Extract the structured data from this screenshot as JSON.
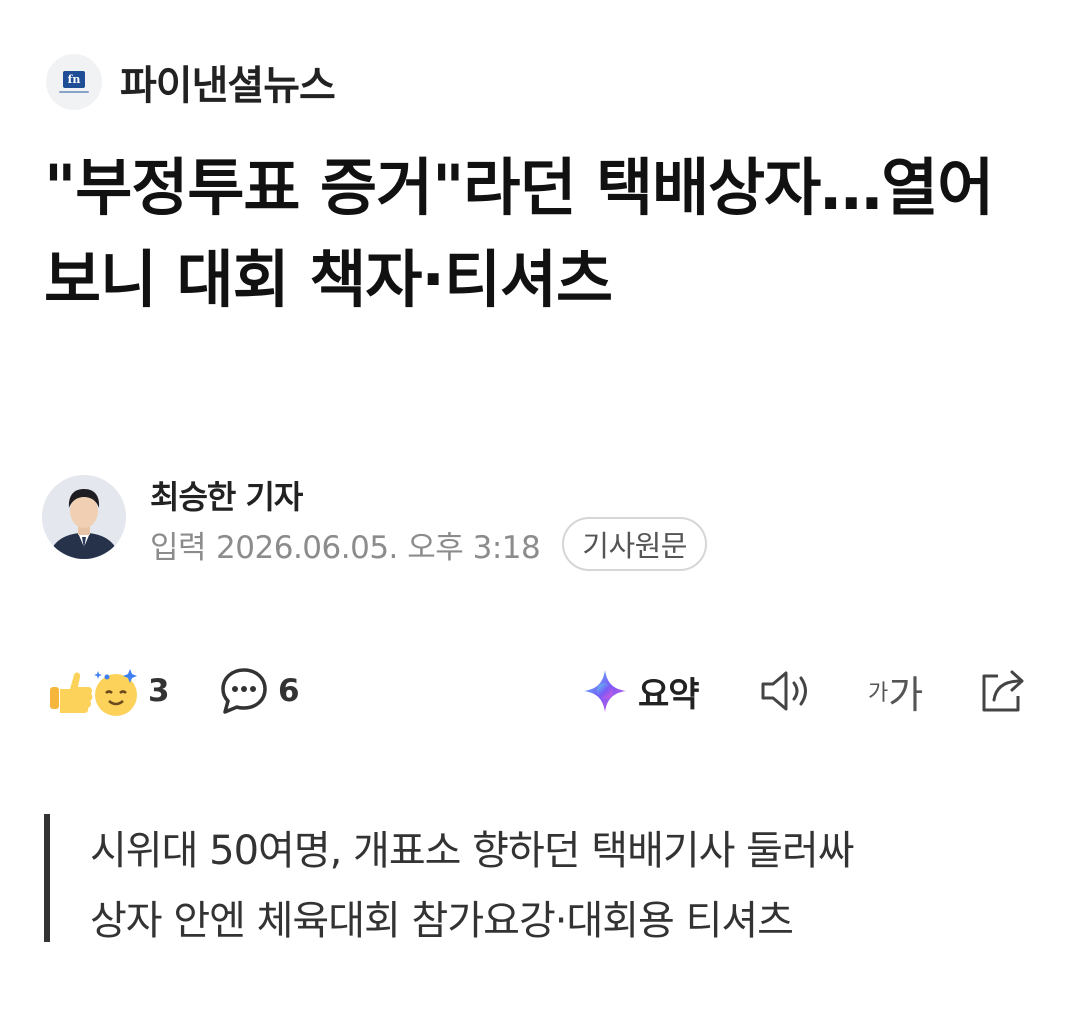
{
  "publisher": {
    "name": "파이낸셜뉴스",
    "logo_text": "fn"
  },
  "headline": "\"부정투표 증거\"라던 택배상자…열어보니 대회 책자·티셔츠",
  "byline": {
    "reporter": "최승한 기자",
    "date_label": "입력",
    "date_value": "2026.06.05. 오후 3:18",
    "origin_button": "기사원문"
  },
  "actions": {
    "reaction_count": "3",
    "comment_count": "6",
    "summary_label": "요약",
    "font_small": "가",
    "font_large": "가",
    "icons": [
      "reaction-emoji-icon",
      "comment-icon",
      "ai-summary-icon",
      "speaker-icon",
      "font-size-icon",
      "share-icon"
    ]
  },
  "subheading": {
    "line1": "시위대 50여명, 개표소 향하던 택배기사 둘러싸",
    "line2": "상자 안엔 체육대회 참가요강·대회용 티셔츠"
  },
  "colors": {
    "accent_border": "#333333",
    "muted_text": "#8c8c8c",
    "logo_blue": "#1f4e96"
  }
}
